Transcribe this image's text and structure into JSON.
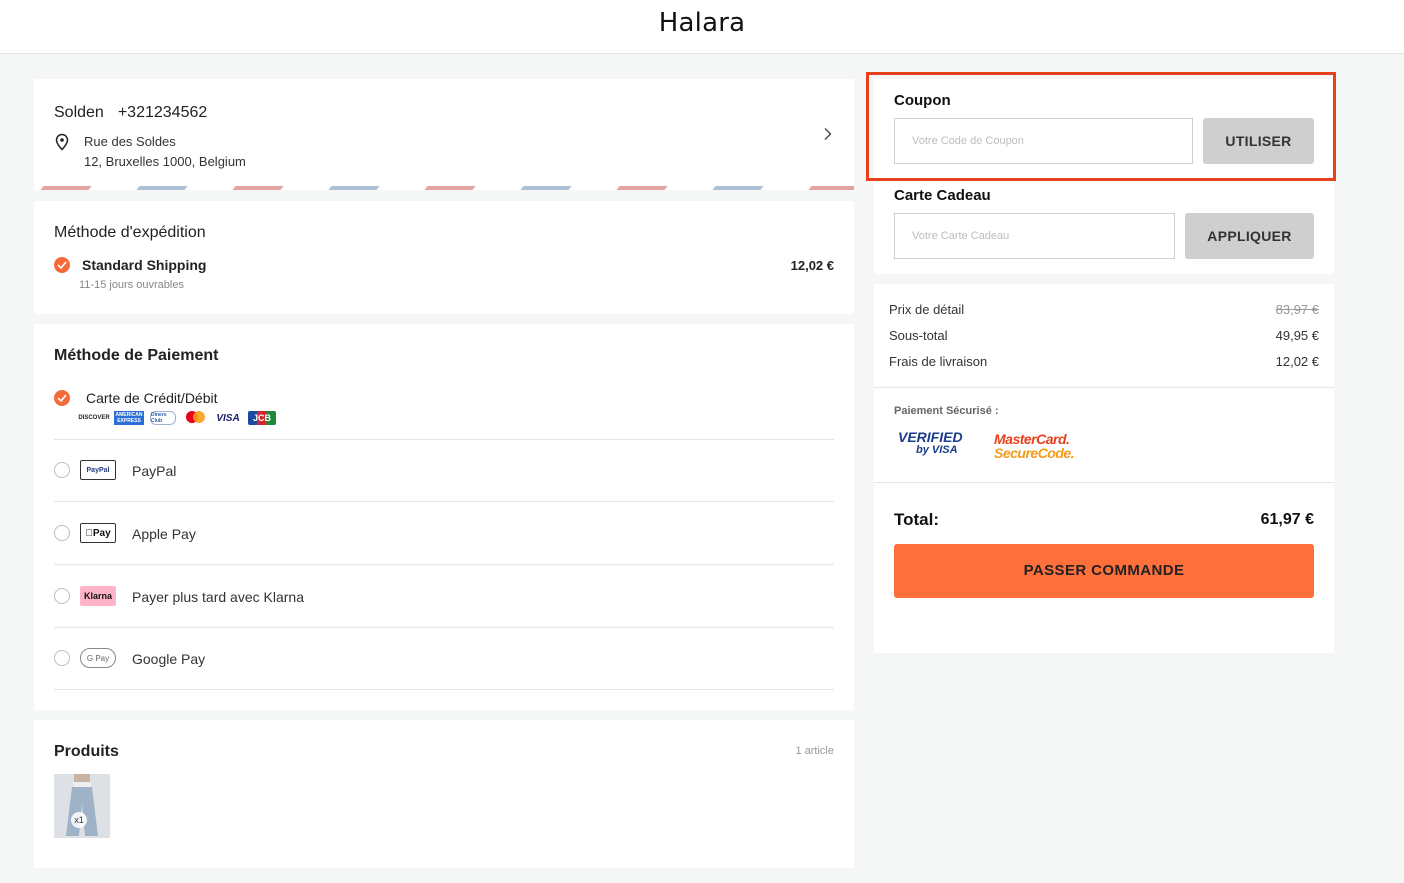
{
  "header": {
    "logo": "Halara"
  },
  "address": {
    "name": "Solden",
    "phone": "+321234562",
    "street": "Rue des Soldes",
    "city": "12, Bruxelles 1000, Belgium"
  },
  "shipping": {
    "title": "Méthode d'expédition",
    "option_name": "Standard Shipping",
    "option_sub": "11-15 jours ouvrables",
    "option_price": "12,02 €"
  },
  "payment": {
    "title": "Méthode de Paiement",
    "card_label": "Carte de Crédit/Débit",
    "card_logos": [
      "DISCOVER",
      "AMERICAN EXPRESS",
      "Diners Club",
      "mastercard",
      "VISA",
      "JCB"
    ],
    "methods": [
      {
        "label": "PayPal",
        "icon": "PayPal"
      },
      {
        "label": "Apple Pay",
        "icon": "Pay"
      },
      {
        "label": "Payer plus tard avec Klarna",
        "icon": "Klarna"
      },
      {
        "label": "Google Pay",
        "icon": "G Pay"
      }
    ]
  },
  "products": {
    "title": "Produits",
    "count": "1 article",
    "qty": "x1"
  },
  "coupon": {
    "title": "Coupon",
    "placeholder": "Votre Code de Coupon",
    "button": "UTILISER"
  },
  "gift_card": {
    "title": "Carte Cadeau",
    "placeholder": "Votre Carte Cadeau",
    "button": "APPLIQUER"
  },
  "summary": {
    "retail_label": "Prix de détail",
    "retail_value": "83,97 €",
    "subtotal_label": "Sous-total",
    "subtotal_value": "49,95 €",
    "shipping_label": "Frais de livraison",
    "shipping_value": "12,02 €",
    "secure_label": "Paiement Sécurisé :",
    "vbv_line1": "VERIFIED",
    "vbv_line2": "by VISA",
    "msc_line1": "MasterCard.",
    "msc_line2": "SecureCode.",
    "total_label": "Total:",
    "total_value": "61,97 €",
    "order_button": "PASSER COMMANDE"
  },
  "colors": {
    "accent": "#ff6f3c",
    "check": "#f56a3b",
    "highlight": "#e8401c"
  }
}
